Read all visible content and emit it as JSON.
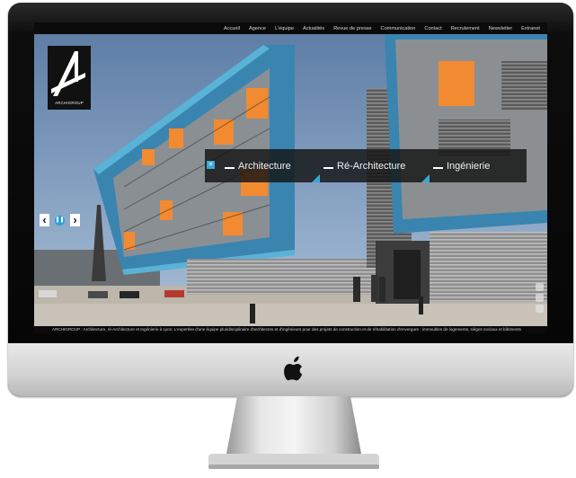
{
  "nav": {
    "items": [
      "Accueil",
      "Agence",
      "L'équipe",
      "Actualités",
      "Revue de presse",
      "Communication",
      "Contact",
      "Recrutement",
      "Newsletter",
      "Extranet"
    ]
  },
  "logo": {
    "text": "ARCHIGROUP"
  },
  "menu": {
    "items": [
      {
        "label": "Architecture"
      },
      {
        "label": "Ré-Architecture"
      },
      {
        "label": "Ingénierie"
      }
    ],
    "close_icon": "close-icon"
  },
  "slider": {
    "prev_icon": "chevron-left-icon",
    "pause_icon": "pause-icon",
    "next_icon": "chevron-right-icon"
  },
  "footer": {
    "text": "ARCHIGROUP : Architecture, ré-Architecture et Ingénierie à Lyon. L'expertise d'une équipe pluridisciplinaire d'architectes et d'ingénieurs pour des projets de construction et de réhabilitation d'envergure : immeubles de logements, sièges sociaux et bâtiments"
  },
  "colors": {
    "accent": "#3aa6d8",
    "facade_orange": "#f28a32",
    "facade_teal": "#4f93b8",
    "bezel": "#0d0d0d",
    "chin": "#d8d8d8"
  }
}
